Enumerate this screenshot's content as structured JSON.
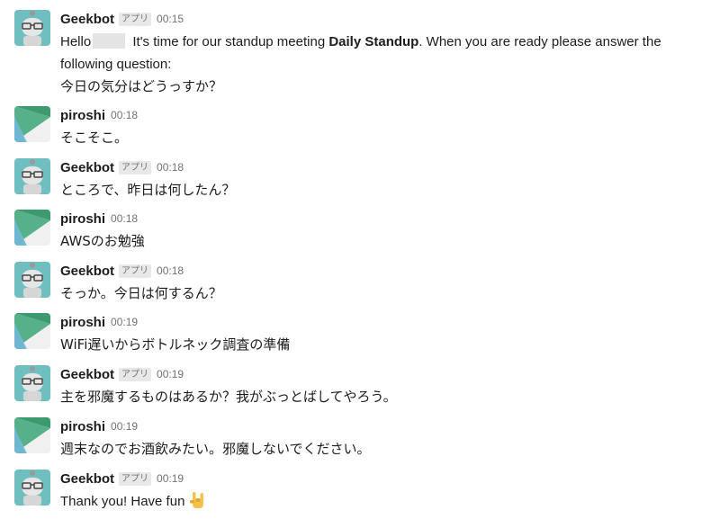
{
  "messages": [
    {
      "sender": "Geekbot",
      "badge": "アプリ",
      "time": "00:15",
      "text_pre": "Hello",
      "text_mid": " It's time for our standup meeting ",
      "meeting": "Daily Standup",
      "text_post": ". When you are ready please answer the",
      "line2": "following question:",
      "line3": "今日の気分はどうっすか？"
    },
    {
      "sender": "piroshi",
      "time": "00:18",
      "text": "そこそこ。"
    },
    {
      "sender": "Geekbot",
      "badge": "アプリ",
      "time": "00:18",
      "text": "ところで、昨日は何したん？"
    },
    {
      "sender": "piroshi",
      "time": "00:18",
      "text": "AWSのお勉強"
    },
    {
      "sender": "Geekbot",
      "badge": "アプリ",
      "time": "00:18",
      "text": "そっか。今日は何するん？"
    },
    {
      "sender": "piroshi",
      "time": "00:19",
      "text": "WiFi遅いからボトルネック調査の準備"
    },
    {
      "sender": "Geekbot",
      "badge": "アプリ",
      "time": "00:19",
      "text": "主を邪魔するものはあるか？我がぶっとばしてやろう。"
    },
    {
      "sender": "piroshi",
      "time": "00:19",
      "text": "週末なのでお酒飲みたい。邪魔しないでください。"
    },
    {
      "sender": "Geekbot",
      "badge": "アプリ",
      "time": "00:19",
      "text": "Thank you! Have fun",
      "emoji": "sign-of-the-horns"
    }
  ]
}
